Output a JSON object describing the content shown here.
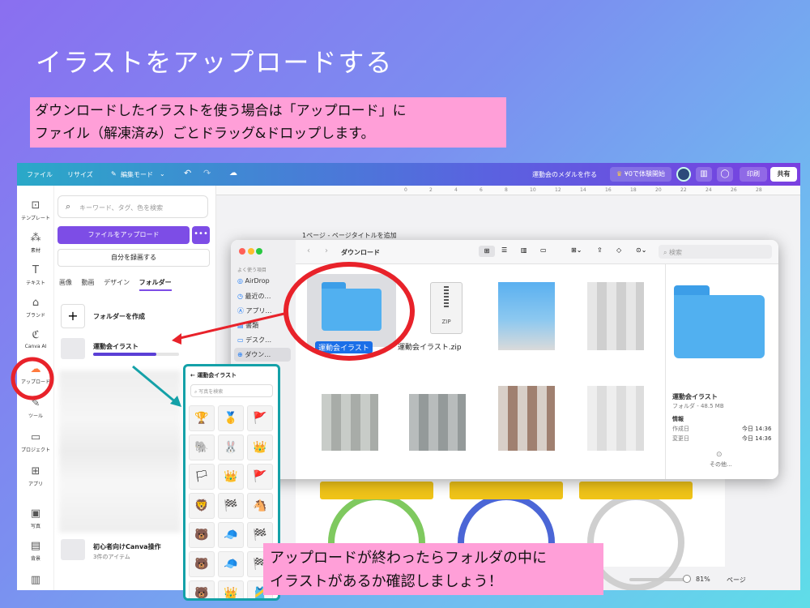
{
  "slide": {
    "title": "イラストをアップロードする",
    "callout_top": [
      "ダウンロードしたイラストを使う場合は「アップロード」に",
      "ファイル（解凍済み）ごとドラッグ&ドロップします。"
    ],
    "callout_bottom": [
      "アップロードが終わったらフォルダの中に",
      "イラストがあるか確認しましょう！"
    ]
  },
  "topbar": {
    "file": "ファイル",
    "resize": "リサイズ",
    "edit_mode": "編集モード",
    "doc_title": "運動会のメダルを作る",
    "trial": "¥0で体験開始",
    "print": "印刷",
    "share": "共有"
  },
  "rail": [
    "テンプレート",
    "素材",
    "テキスト",
    "ブランド",
    "Canva AI",
    "アップロード",
    "ツール",
    "プロジェクト",
    "アプリ",
    "写真",
    "背景"
  ],
  "panel": {
    "search_placeholder": "キーワード、タグ、色を検索",
    "upload_button": "ファイルをアップロード",
    "more_button": "•••",
    "record_button": "自分を録画する",
    "tabs": [
      "画像",
      "動画",
      "デザイン",
      "フォルダー"
    ],
    "create_folder": "フォルダーを作成",
    "folders": [
      {
        "name": "運動会イラスト",
        "meta": ""
      },
      {
        "name": "初心者向けCanva操作",
        "meta": "3件のアイテム"
      }
    ]
  },
  "canvas": {
    "page_title": "1ページ - ページタイトルを追加",
    "ruler": [
      "0",
      "2",
      "4",
      "6",
      "8",
      "10",
      "12",
      "14",
      "16",
      "18",
      "20",
      "22",
      "24",
      "26",
      "28"
    ],
    "zoom": "81%",
    "page_label": "ページ"
  },
  "finder": {
    "path": "ダウンロード",
    "search_placeholder": "検索",
    "sidebar_header": "よく使う項目",
    "sidebar": [
      "AirDrop",
      "最近の…",
      "アプリ…",
      "書類",
      "デスク…",
      "ダウン…"
    ],
    "files": [
      {
        "name": "運動会イラスト",
        "kind": "folder"
      },
      {
        "name": "運動会イラスト.zip",
        "kind": "zip"
      }
    ],
    "zip_label": "ZIP",
    "info": {
      "name": "運動会イラスト",
      "kind": "フォルダ - 48.5 MB",
      "section": "情報",
      "created_label": "作成日",
      "created": "今日 14:36",
      "modified_label": "変更日",
      "modified": "今日 14:36",
      "more": "その他..."
    }
  },
  "phone": {
    "title": "運動会イラスト",
    "search_placeholder": "写真を検索",
    "icons": [
      "🏆",
      "🥇",
      "🚩",
      "🐘",
      "🐰",
      "👑",
      "🏳",
      "👑",
      "🚩",
      "🦁",
      "🏁",
      "🐴",
      "🐻",
      "🧢",
      "🏁",
      "🐻",
      "🧢",
      "🏁",
      "🐻",
      "👑",
      "🎽"
    ]
  }
}
